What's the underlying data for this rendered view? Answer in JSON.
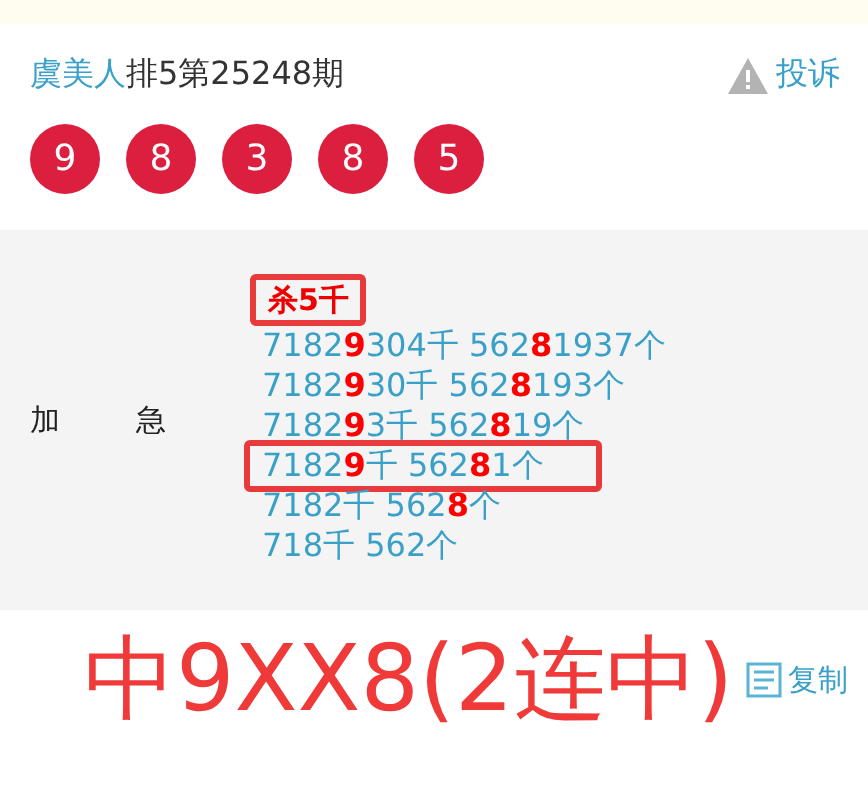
{
  "header": {
    "name": "虞美人",
    "title": "排5第25248期",
    "complaint": "投诉"
  },
  "balls": [
    "9",
    "8",
    "3",
    "8",
    "5"
  ],
  "detail": {
    "label": "加急",
    "tag": "杀5千",
    "lines": [
      {
        "text": "7182**9**304千 562**8**1937个",
        "boxed": false
      },
      {
        "text": "7182**9**30千 562**8**193个",
        "boxed": false
      },
      {
        "text": "7182**9**3千 562**8**19个",
        "boxed": false
      },
      {
        "text": "7182**9**千 562**8**1个",
        "boxed": true
      },
      {
        "text": "7182千 562**8**个",
        "boxed": false
      },
      {
        "text": "718千 562个",
        "boxed": false
      }
    ]
  },
  "annotation": "中9XX8(2连中)",
  "copy": "复制"
}
